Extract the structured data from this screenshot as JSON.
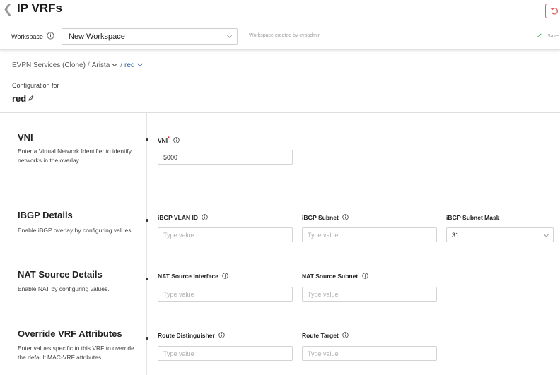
{
  "header": {
    "title": "IP VRFs"
  },
  "workspace": {
    "label": "Workspace",
    "selected": "New Workspace",
    "created_by": "Workspace created by cvpadmin",
    "save_label": "Save"
  },
  "breadcrumb": {
    "items": [
      "EVPN Services (Clone)",
      "Arista",
      "red"
    ]
  },
  "config": {
    "label": "Configuration for",
    "name": "red"
  },
  "sections": {
    "vni": {
      "title": "VNI",
      "description": "Enter a Virtual Network Identifier to identify networks in the overlay",
      "field_label": "VNI",
      "required_mark": "*",
      "value": "5000"
    },
    "ibgp": {
      "title": "IBGP Details",
      "description": "Enable iBGP overlay by configuring values.",
      "vlan_label": "iBGP VLAN ID",
      "subnet_label": "iBGP Subnet",
      "mask_label": "iBGP Subnet Mask",
      "mask_value": "31",
      "placeholder": "Type value"
    },
    "nat": {
      "title": "NAT Source Details",
      "description": "Enable NAT by configuring values.",
      "interface_label": "NAT Source Interface",
      "subnet_label": "NAT Source Subnet",
      "placeholder": "Type value"
    },
    "override": {
      "title": "Override VRF Attributes",
      "description": "Enter values specific to this VRF to override the default MAC-VRF attributes.",
      "rd_label": "Route Distinguisher",
      "rt_label": "Route Target",
      "placeholder": "Type value"
    }
  },
  "icons": {
    "back": "chevron-left-icon",
    "restore": "restore-icon",
    "info": "info-icon",
    "edit": "pencil-icon",
    "dropdown": "chevron-down-icon",
    "saved": "check-icon"
  },
  "colors": {
    "accent": "#1a5ca8",
    "required": "#d9363e",
    "success": "#2e9e44",
    "danger": "#e06060"
  }
}
